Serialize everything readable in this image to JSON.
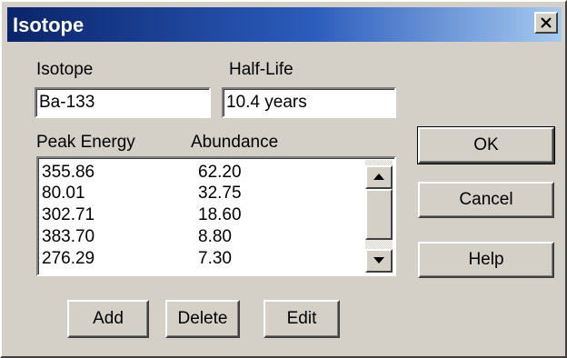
{
  "window": {
    "title": "Isotope",
    "close_icon": "close-icon"
  },
  "fields": {
    "isotope_label": "Isotope",
    "isotope_value": "Ba-133",
    "halflife_label": "Half-Life",
    "halflife_value": "10.4 years"
  },
  "peaks": {
    "col_energy": "Peak Energy",
    "col_abundance": "Abundance",
    "rows": [
      {
        "energy": "355.86",
        "abundance": "62.20"
      },
      {
        "energy": "80.01",
        "abundance": "32.75"
      },
      {
        "energy": "302.71",
        "abundance": "18.60"
      },
      {
        "energy": "383.70",
        "abundance": "8.80"
      },
      {
        "energy": "276.29",
        "abundance": "7.30"
      }
    ]
  },
  "buttons": {
    "ok": "OK",
    "cancel": "Cancel",
    "help": "Help",
    "add": "Add",
    "delete": "Delete",
    "edit": "Edit"
  }
}
